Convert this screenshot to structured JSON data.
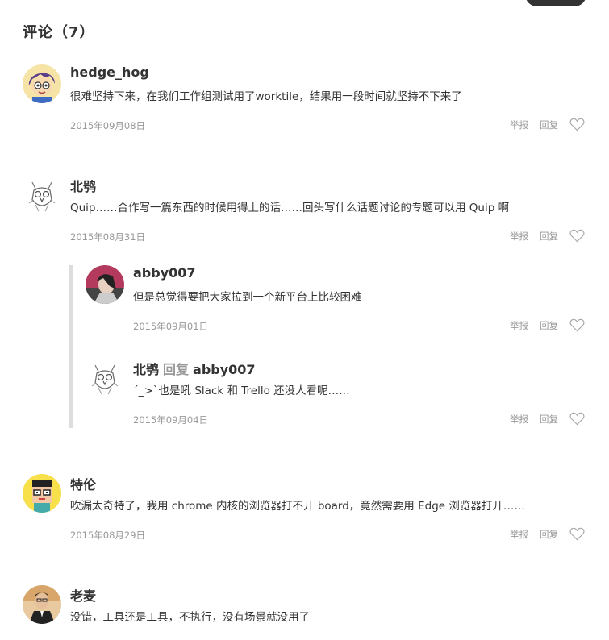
{
  "section_title": "评论（7）",
  "action_report": "举报",
  "action_reply": "回复",
  "reply_word": "回复",
  "comments": [
    {
      "author": "hedge_hog",
      "text": "很难坚持下来，在我们工作组测试用了worktile，结果用一段时间就坚持不下来了",
      "date": "2015年09月08日",
      "avatar": "cartoon-boy-avatar"
    },
    {
      "author": "北鸮",
      "text": "Quip……合作写一篇东西的时候用得上的话……回头写什么话题讨论的专题可以用 Quip 啊",
      "date": "2015年08月31日",
      "avatar": "owl-sketch-avatar"
    },
    {
      "author": "特伦",
      "text": "吹漏太奇特了，我用 chrome 内核的浏览器打不开 board，竟然需要用 Edge 浏览器打开……",
      "date": "2015年08月29日",
      "avatar": "pixel-face-avatar"
    },
    {
      "author": "老麦",
      "text": "没错，工具还是工具，不执行，没有场景就没用了",
      "date": "",
      "avatar": "photo-man-avatar"
    }
  ],
  "replies": [
    {
      "author": "abby007",
      "text": "但是总觉得要把大家拉到一个新平台上比较困难",
      "date": "2015年09月01日",
      "avatar": "photo-woman-avatar"
    },
    {
      "author": "北鸮",
      "reply_to": "abby007",
      "text": "´_>`也是吼 Slack 和 Trello 还没人看呢……",
      "date": "2015年09月04日",
      "avatar": "owl-sketch-avatar"
    }
  ]
}
